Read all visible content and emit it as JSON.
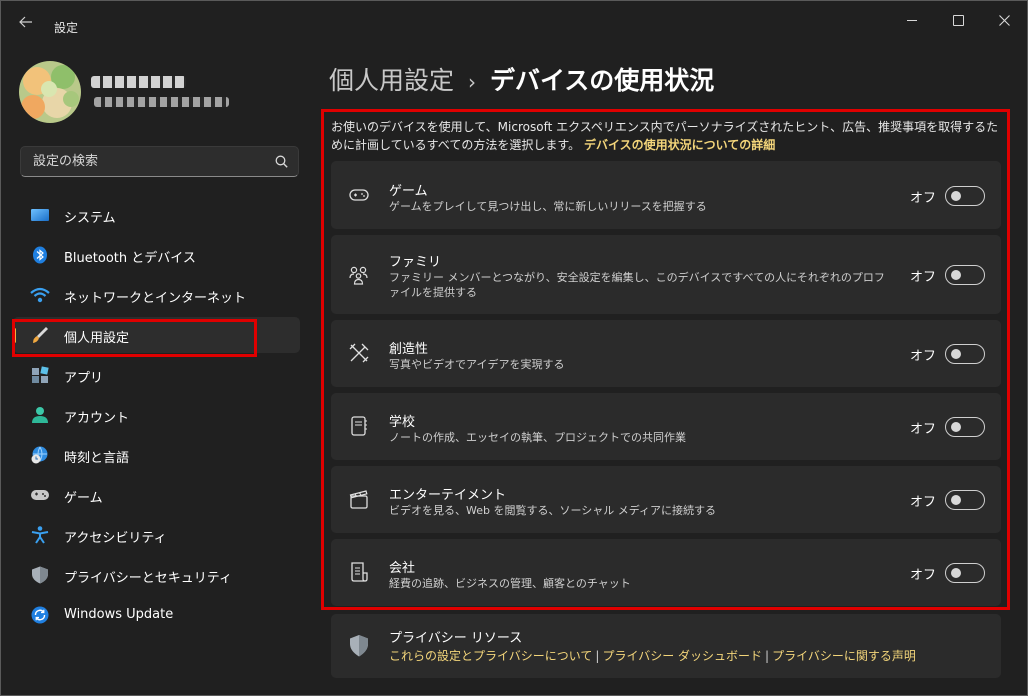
{
  "window": {
    "title": "設定"
  },
  "search": {
    "placeholder": "設定の検索"
  },
  "sidebar": {
    "items": [
      {
        "label": "システム"
      },
      {
        "label": "Bluetooth とデバイス"
      },
      {
        "label": "ネットワークとインターネット"
      },
      {
        "label": "個人用設定",
        "selected": true
      },
      {
        "label": "アプリ"
      },
      {
        "label": "アカウント"
      },
      {
        "label": "時刻と言語"
      },
      {
        "label": "ゲーム"
      },
      {
        "label": "アクセシビリティ"
      },
      {
        "label": "プライバシーとセキュリティ"
      },
      {
        "label": "Windows Update"
      }
    ]
  },
  "breadcrumb": {
    "parent": "個人用設定",
    "separator": "›",
    "current": "デバイスの使用状況"
  },
  "description": {
    "text": "お使いのデバイスを使用して、Microsoft エクスペリエンス内でパーソナライズされたヒント、広告、推奨事項を取得するために計画しているすべての方法を選択します。",
    "link": "デバイスの使用状況についての詳細"
  },
  "cards": [
    {
      "icon": "gamepad-icon",
      "title": "ゲーム",
      "subtitle": "ゲームをプレイして見つけ出し、常に新しいリリースを把握する",
      "state": "オフ",
      "on": false
    },
    {
      "icon": "family-icon",
      "title": "ファミリ",
      "subtitle": "ファミリー メンバーとつながり、安全設定を編集し、このデバイスですべての人にそれぞれのプロファイルを提供する",
      "state": "オフ",
      "on": false
    },
    {
      "icon": "creativity-icon",
      "title": "創造性",
      "subtitle": "写真やビデオでアイデアを実現する",
      "state": "オフ",
      "on": false
    },
    {
      "icon": "school-icon",
      "title": "学校",
      "subtitle": "ノートの作成、エッセイの執筆、プロジェクトでの共同作業",
      "state": "オフ",
      "on": false
    },
    {
      "icon": "clapperboard-icon",
      "title": "エンターテイメント",
      "subtitle": "ビデオを見る、Web を閲覧する、ソーシャル メディアに接続する",
      "state": "オフ",
      "on": false
    },
    {
      "icon": "business-icon",
      "title": "会社",
      "subtitle": "経費の追跡、ビジネスの管理、顧客とのチャット",
      "state": "オフ",
      "on": false
    }
  ],
  "privacy": {
    "title": "プライバシー リソース",
    "links": [
      "これらの設定とプライバシーについて",
      "プライバシー ダッシュボード",
      "プライバシーに関する声明"
    ],
    "separator": "|"
  },
  "colors": {
    "accent": "#f3d57a",
    "selection_bar": "#f0b040",
    "highlight": "#e00000",
    "background": "#202020",
    "card": "#2b2b2b"
  }
}
